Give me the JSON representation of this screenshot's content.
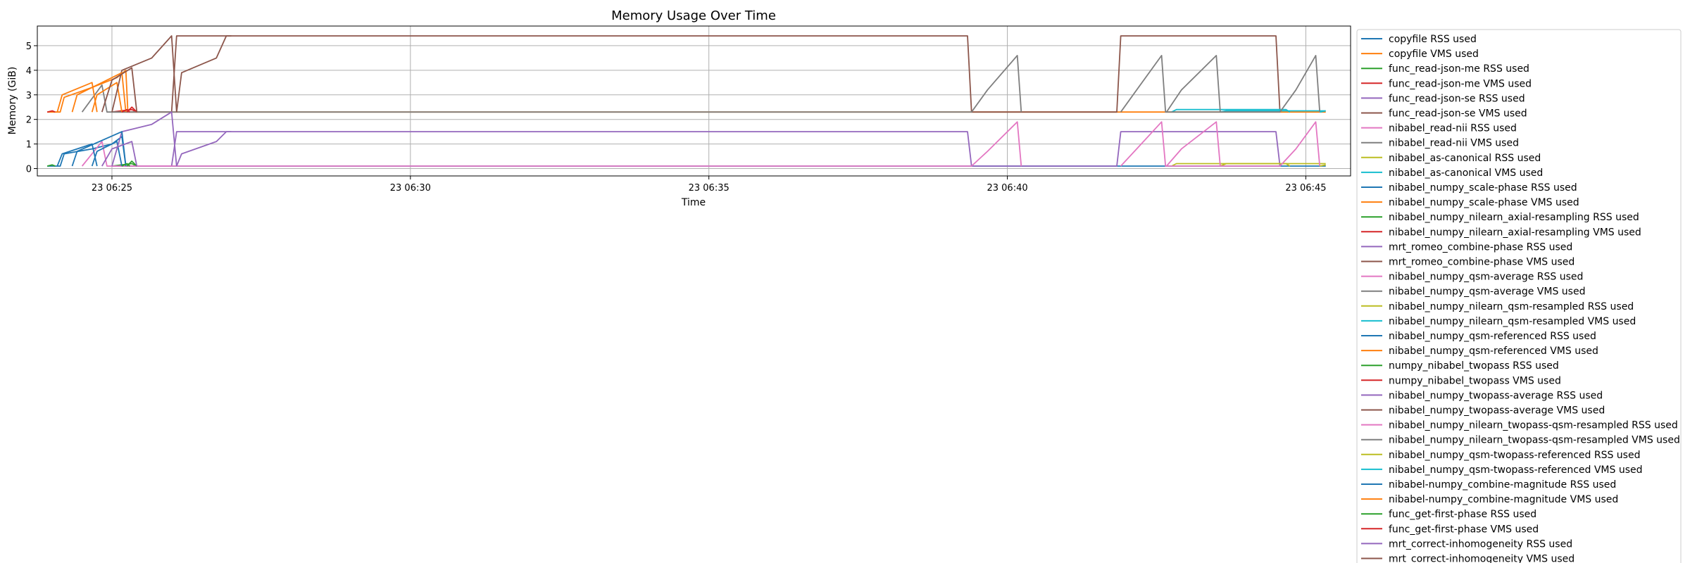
{
  "chart_data": {
    "type": "line",
    "title": "Memory Usage Over Time",
    "xlabel": "Time",
    "ylabel": "Memory (GiB)",
    "xlim": [
      "23 06:23:45",
      "23 06:45:45"
    ],
    "ylim": [
      -0.3,
      5.8
    ],
    "grid": true,
    "legend_placement": "outside-right",
    "x_ticks": [
      "23 06:25",
      "23 06:30",
      "23 06:35",
      "23 06:40",
      "23 06:45"
    ],
    "x_tick_values": [
      "23 06:25:00",
      "23 06:30:00",
      "23 06:35:00",
      "23 06:40:00",
      "23 06:45:00"
    ],
    "y_ticks": [
      0,
      1,
      2,
      3,
      4,
      5
    ],
    "series": [
      {
        "name": "copyfile RSS used",
        "color": "#1f77b4",
        "points": [
          [
            "23 06:23:55",
            0.1
          ],
          [
            "23 06:24:08",
            0.1
          ],
          [
            "23 06:24:12",
            0.6
          ],
          [
            "23 06:24:40",
            0.8
          ],
          [
            "23 06:25:00",
            1.0
          ],
          [
            "23 06:25:10",
            1.3
          ],
          [
            "23 06:25:14",
            0.1
          ],
          [
            "23 06:45:20",
            0.1
          ]
        ]
      },
      {
        "name": "copyfile VMS used",
        "color": "#ff7f0e",
        "points": [
          [
            "23 06:23:55",
            2.3
          ],
          [
            "23 06:24:08",
            2.3
          ],
          [
            "23 06:24:12",
            2.9
          ],
          [
            "23 06:24:40",
            3.3
          ],
          [
            "23 06:25:05",
            3.7
          ],
          [
            "23 06:25:14",
            4.0
          ],
          [
            "23 06:25:16",
            2.3
          ],
          [
            "23 06:45:20",
            2.3
          ]
        ]
      },
      {
        "name": "func_read-json-me RSS used",
        "color": "#2ca02c",
        "points": [
          [
            "23 06:25:00",
            0.1
          ],
          [
            "23 06:25:20",
            0.2
          ],
          [
            "23 06:25:25",
            0.1
          ]
        ]
      },
      {
        "name": "func_read-json-me VMS used",
        "color": "#d62728",
        "points": [
          [
            "23 06:25:00",
            2.3
          ],
          [
            "23 06:25:20",
            2.4
          ],
          [
            "23 06:25:25",
            2.3
          ]
        ]
      },
      {
        "name": "func_read-json-se RSS used",
        "color": "#9467bd",
        "points": [
          [
            "23 06:25:00",
            0.1
          ],
          [
            "23 06:26:00",
            0.1
          ],
          [
            "23 06:26:05",
            1.5
          ],
          [
            "23 06:39:20",
            1.5
          ],
          [
            "23 06:39:24",
            0.1
          ],
          [
            "23 06:41:50",
            0.1
          ],
          [
            "23 06:41:54",
            1.5
          ],
          [
            "23 06:44:30",
            1.5
          ],
          [
            "23 06:44:34",
            0.1
          ]
        ]
      },
      {
        "name": "func_read-json-se VMS used",
        "color": "#8c564b",
        "points": [
          [
            "23 06:25:00",
            2.3
          ],
          [
            "23 06:26:00",
            2.3
          ],
          [
            "23 06:26:05",
            5.4
          ],
          [
            "23 06:39:20",
            5.4
          ],
          [
            "23 06:39:24",
            2.3
          ],
          [
            "23 06:41:50",
            2.3
          ],
          [
            "23 06:41:54",
            5.4
          ],
          [
            "23 06:44:30",
            5.4
          ],
          [
            "23 06:44:34",
            2.3
          ]
        ]
      },
      {
        "name": "nibabel_read-nii RSS used",
        "color": "#e377c2",
        "points": [
          [
            "23 06:24:30",
            0.1
          ],
          [
            "23 06:24:50",
            1.1
          ],
          [
            "23 06:24:55",
            0.1
          ],
          [
            "23 06:39:24",
            0.1
          ],
          [
            "23 06:39:40",
            0.7
          ],
          [
            "23 06:40:10",
            1.9
          ],
          [
            "23 06:40:14",
            0.1
          ]
        ]
      },
      {
        "name": "nibabel_read-nii VMS used",
        "color": "#7f7f7f",
        "points": [
          [
            "23 06:24:30",
            2.3
          ],
          [
            "23 06:24:50",
            3.4
          ],
          [
            "23 06:24:55",
            2.3
          ],
          [
            "23 06:39:24",
            2.3
          ],
          [
            "23 06:39:40",
            3.2
          ],
          [
            "23 06:40:10",
            4.6
          ],
          [
            "23 06:40:14",
            2.3
          ]
        ]
      },
      {
        "name": "nibabel_as-canonical RSS used",
        "color": "#bcbd22",
        "points": [
          [
            "23 06:42:45",
            0.1
          ],
          [
            "23 06:42:50",
            0.2
          ],
          [
            "23 06:44:40",
            0.2
          ],
          [
            "23 06:44:44",
            0.1
          ]
        ]
      },
      {
        "name": "nibabel_as-canonical VMS used",
        "color": "#17becf",
        "points": [
          [
            "23 06:42:45",
            2.3
          ],
          [
            "23 06:42:50",
            2.4
          ],
          [
            "23 06:44:40",
            2.4
          ],
          [
            "23 06:44:44",
            2.3
          ]
        ]
      },
      {
        "name": "nibabel_numpy_scale-phase RSS used",
        "color": "#1f77b4",
        "points": [
          [
            "23 06:24:40",
            0.1
          ],
          [
            "23 06:24:45",
            0.7
          ],
          [
            "23 06:25:05",
            1.1
          ],
          [
            "23 06:25:10",
            0.1
          ]
        ]
      },
      {
        "name": "nibabel_numpy_scale-phase VMS used",
        "color": "#ff7f0e",
        "points": [
          [
            "23 06:24:40",
            2.3
          ],
          [
            "23 06:24:45",
            3.0
          ],
          [
            "23 06:25:05",
            3.5
          ],
          [
            "23 06:25:10",
            2.3
          ]
        ]
      },
      {
        "name": "nibabel_numpy_nilearn_axial-resampling RSS used",
        "color": "#2ca02c",
        "points": [
          [
            "23 06:25:15",
            0.1
          ],
          [
            "23 06:25:20",
            0.3
          ],
          [
            "23 06:25:25",
            0.1
          ]
        ]
      },
      {
        "name": "nibabel_numpy_nilearn_axial-resampling VMS used",
        "color": "#d62728",
        "points": [
          [
            "23 06:25:15",
            2.3
          ],
          [
            "23 06:25:20",
            2.5
          ],
          [
            "23 06:25:25",
            2.3
          ]
        ]
      },
      {
        "name": "mrt_romeo_combine-phase RSS used",
        "color": "#9467bd",
        "points": [
          [
            "23 06:25:00",
            0.1
          ],
          [
            "23 06:25:10",
            1.5
          ],
          [
            "23 06:25:40",
            1.8
          ],
          [
            "23 06:26:00",
            2.3
          ],
          [
            "23 06:26:05",
            0.1
          ]
        ]
      },
      {
        "name": "mrt_romeo_combine-phase VMS used",
        "color": "#8c564b",
        "points": [
          [
            "23 06:25:00",
            2.3
          ],
          [
            "23 06:25:10",
            4.0
          ],
          [
            "23 06:25:40",
            4.5
          ],
          [
            "23 06:26:00",
            5.4
          ],
          [
            "23 06:26:05",
            2.3
          ]
        ]
      },
      {
        "name": "nibabel_numpy_qsm-average RSS used",
        "color": "#e377c2",
        "points": [
          [
            "23 06:42:40",
            0.1
          ],
          [
            "23 06:42:55",
            0.8
          ],
          [
            "23 06:43:30",
            1.9
          ],
          [
            "23 06:43:34",
            0.1
          ]
        ]
      },
      {
        "name": "nibabel_numpy_qsm-average VMS used",
        "color": "#7f7f7f",
        "points": [
          [
            "23 06:42:40",
            2.3
          ],
          [
            "23 06:42:55",
            3.2
          ],
          [
            "23 06:43:30",
            4.6
          ],
          [
            "23 06:43:34",
            2.3
          ]
        ]
      },
      {
        "name": "nibabel_numpy_nilearn_qsm-resampled RSS used",
        "color": "#bcbd22",
        "points": [
          [
            "23 06:43:34",
            0.1
          ],
          [
            "23 06:43:40",
            0.2
          ],
          [
            "23 06:45:20",
            0.2
          ]
        ]
      },
      {
        "name": "nibabel_numpy_nilearn_qsm-resampled VMS used",
        "color": "#17becf",
        "points": [
          [
            "23 06:43:34",
            2.3
          ],
          [
            "23 06:43:40",
            2.35
          ],
          [
            "23 06:45:20",
            2.35
          ]
        ]
      },
      {
        "name": "nibabel_numpy_qsm-referenced RSS used",
        "color": "#1f77b4",
        "points": [
          [
            "23 06:24:20",
            0.1
          ],
          [
            "23 06:24:25",
            0.7
          ],
          [
            "23 06:25:10",
            1.5
          ],
          [
            "23 06:25:14",
            0.1
          ]
        ]
      },
      {
        "name": "nibabel_numpy_qsm-referenced VMS used",
        "color": "#ff7f0e",
        "points": [
          [
            "23 06:24:20",
            2.3
          ],
          [
            "23 06:24:25",
            3.0
          ],
          [
            "23 06:25:10",
            3.9
          ],
          [
            "23 06:25:14",
            2.3
          ]
        ]
      },
      {
        "name": "numpy_nibabel_twopass RSS used",
        "color": "#2ca02c",
        "points": [
          [
            "23 06:25:10",
            0.1
          ],
          [
            "23 06:25:15",
            0.2
          ],
          [
            "23 06:25:18",
            0.1
          ]
        ]
      },
      {
        "name": "numpy_nibabel_twopass VMS used",
        "color": "#d62728",
        "points": [
          [
            "23 06:25:10",
            2.3
          ],
          [
            "23 06:25:15",
            2.4
          ],
          [
            "23 06:25:18",
            2.3
          ]
        ]
      },
      {
        "name": "nibabel_numpy_twopass-average RSS used",
        "color": "#9467bd",
        "points": [
          [
            "23 06:26:05",
            0.1
          ],
          [
            "23 06:26:10",
            0.6
          ],
          [
            "23 06:26:45",
            1.1
          ],
          [
            "23 06:26:55",
            1.5
          ],
          [
            "23 06:27:00",
            1.5
          ]
        ]
      },
      {
        "name": "nibabel_numpy_twopass-average VMS used",
        "color": "#8c564b",
        "points": [
          [
            "23 06:26:05",
            2.3
          ],
          [
            "23 06:26:10",
            3.9
          ],
          [
            "23 06:26:45",
            4.5
          ],
          [
            "23 06:26:55",
            5.4
          ],
          [
            "23 06:27:00",
            5.4
          ]
        ]
      },
      {
        "name": "nibabel_numpy_nilearn_twopass-qsm-resampled RSS used",
        "color": "#e377c2",
        "points": [
          [
            "23 06:41:54",
            0.1
          ],
          [
            "23 06:42:10",
            0.8
          ],
          [
            "23 06:42:35",
            1.9
          ],
          [
            "23 06:42:39",
            0.1
          ],
          [
            "23 06:44:34",
            0.1
          ],
          [
            "23 06:44:50",
            0.8
          ],
          [
            "23 06:45:10",
            1.9
          ],
          [
            "23 06:45:14",
            0.1
          ]
        ]
      },
      {
        "name": "nibabel_numpy_nilearn_twopass-qsm-resampled VMS used",
        "color": "#7f7f7f",
        "points": [
          [
            "23 06:41:54",
            2.3
          ],
          [
            "23 06:42:10",
            3.2
          ],
          [
            "23 06:42:35",
            4.6
          ],
          [
            "23 06:42:39",
            2.3
          ],
          [
            "23 06:44:34",
            2.3
          ],
          [
            "23 06:44:50",
            3.2
          ],
          [
            "23 06:45:10",
            4.6
          ],
          [
            "23 06:45:14",
            2.3
          ]
        ]
      },
      {
        "name": "nibabel_numpy_qsm-twopass-referenced RSS used",
        "color": "#bcbd22",
        "points": [
          [
            "23 06:45:14",
            0.1
          ],
          [
            "23 06:45:20",
            0.15
          ]
        ]
      },
      {
        "name": "nibabel_numpy_qsm-twopass-referenced VMS used",
        "color": "#17becf",
        "points": [
          [
            "23 06:45:14",
            2.3
          ],
          [
            "23 06:45:20",
            2.35
          ]
        ]
      },
      {
        "name": "nibabel-numpy_combine-magnitude RSS used",
        "color": "#1f77b4",
        "points": [
          [
            "23 06:24:05",
            0.1
          ],
          [
            "23 06:24:10",
            0.6
          ],
          [
            "23 06:24:40",
            1.0
          ],
          [
            "23 06:24:45",
            0.1
          ]
        ]
      },
      {
        "name": "nibabel-numpy_combine-magnitude VMS used",
        "color": "#ff7f0e",
        "points": [
          [
            "23 06:24:05",
            2.3
          ],
          [
            "23 06:24:10",
            3.0
          ],
          [
            "23 06:24:40",
            3.5
          ],
          [
            "23 06:24:45",
            2.3
          ]
        ]
      },
      {
        "name": "func_get-first-phase RSS used",
        "color": "#2ca02c",
        "points": [
          [
            "23 06:23:55",
            0.1
          ],
          [
            "23 06:24:00",
            0.15
          ],
          [
            "23 06:24:03",
            0.1
          ]
        ]
      },
      {
        "name": "func_get-first-phase VMS used",
        "color": "#d62728",
        "points": [
          [
            "23 06:23:55",
            2.3
          ],
          [
            "23 06:24:00",
            2.35
          ],
          [
            "23 06:24:03",
            2.3
          ]
        ]
      },
      {
        "name": "mrt_correct-inhomogeneity RSS used",
        "color": "#9467bd",
        "points": [
          [
            "23 06:24:50",
            0.1
          ],
          [
            "23 06:25:00",
            0.8
          ],
          [
            "23 06:25:20",
            1.1
          ],
          [
            "23 06:25:25",
            0.1
          ]
        ]
      },
      {
        "name": "mrt_correct-inhomogeneity VMS used",
        "color": "#8c564b",
        "points": [
          [
            "23 06:24:50",
            2.3
          ],
          [
            "23 06:25:00",
            3.6
          ],
          [
            "23 06:25:20",
            4.1
          ],
          [
            "23 06:25:25",
            2.3
          ]
        ]
      }
    ]
  }
}
